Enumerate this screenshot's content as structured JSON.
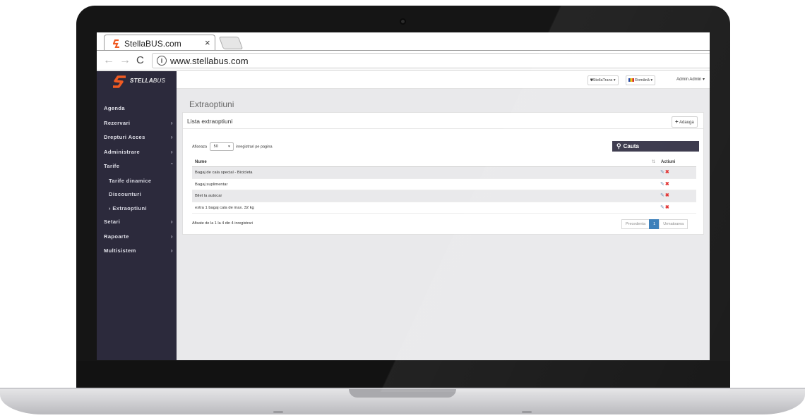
{
  "browser": {
    "tab_title": "StellaBUS.com",
    "tab_close": "×",
    "url": "www.stellabus.com",
    "back": "←",
    "forward": "→",
    "reload": "C",
    "info": "i"
  },
  "brand": {
    "name_bold": "STELLA",
    "name_rest": "BUS",
    "accent": "#f05a22"
  },
  "topbar": {
    "company": "StellaTrans",
    "language": "Română",
    "user": "Admin Admin"
  },
  "sidebar": {
    "items": [
      {
        "label": "Agenda",
        "chevron": ""
      },
      {
        "label": "Rezervari",
        "chevron": "›"
      },
      {
        "label": "Drepturi Acces",
        "chevron": "›"
      },
      {
        "label": "Administrare",
        "chevron": "›"
      },
      {
        "label": "Tarife",
        "chevron": "ˆ"
      },
      {
        "label": "Tarife dinamice",
        "chevron": ""
      },
      {
        "label": "Discounturi",
        "chevron": ""
      },
      {
        "label": "› Extraoptiuni",
        "chevron": ""
      },
      {
        "label": "Setari",
        "chevron": "›"
      },
      {
        "label": "Rapoarte",
        "chevron": "›"
      },
      {
        "label": "Multisistem",
        "chevron": "›"
      }
    ]
  },
  "page": {
    "title": "Extraoptiuni",
    "panel_title": "Lista extraoptiuni",
    "add_label": "Adauga",
    "show_prefix": "Afiseaza",
    "page_size": "50",
    "show_suffix": "inregistrari pe pagina",
    "search_label": "Cauta",
    "columns": [
      "Nume",
      "Actiuni"
    ],
    "sort_indicator": "⇅",
    "rows": [
      "Bagaj de cala special - Bicicleta",
      "Bagaj suplimentar",
      "Bilet la autocar",
      "extra 1 bagaj cala de max. 32 kg"
    ],
    "info": "Afisate de la 1 la 4 din 4 inregistrari",
    "pager": {
      "prev": "Precedenta",
      "current": "1",
      "next": "Urmatoarea"
    }
  },
  "colors": {
    "sidebar_bg": "#2c2a3c",
    "search_bg": "#343246",
    "pager_active": "#337ab7",
    "delete": "#e02b2b",
    "edit": "#6b8fb5"
  }
}
